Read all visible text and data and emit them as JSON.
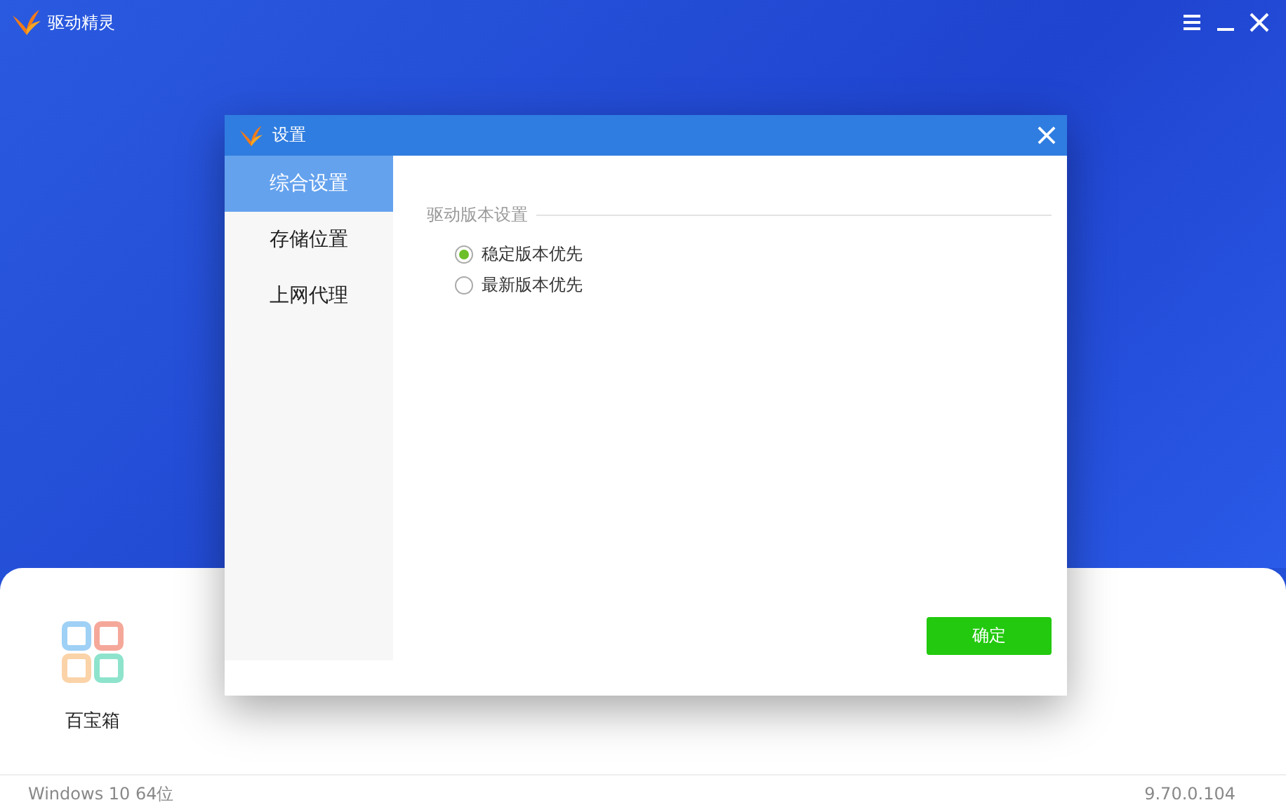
{
  "app": {
    "title": "驱动精灵"
  },
  "tools": [
    {
      "label": "百宝箱"
    }
  ],
  "status_bar": {
    "os": "Windows 10 64位",
    "version": "9.70.0.104"
  },
  "dialog": {
    "title": "设置",
    "nav": [
      {
        "label": "综合设置",
        "selected": true
      },
      {
        "label": "存储位置",
        "selected": false
      },
      {
        "label": "上网代理",
        "selected": false
      }
    ],
    "section": "驱动版本设置",
    "options": [
      {
        "label": "稳定版本优先",
        "selected": true
      },
      {
        "label": "最新版本优先",
        "selected": false
      }
    ],
    "ok_button": "确定"
  }
}
